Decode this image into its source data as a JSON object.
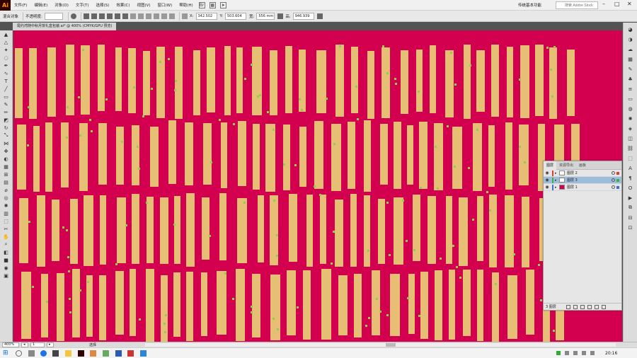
{
  "menubar": {
    "logo": "Ai",
    "items": [
      "文件(F)",
      "编辑(E)",
      "对象(O)",
      "文字(T)",
      "选择(S)",
      "效果(C)",
      "视图(V)",
      "窗口(W)",
      "帮助(H)"
    ],
    "workspace": "传统基本功能",
    "search_placeholder": "搜索 Adobe Stock"
  },
  "controlbar": {
    "mode_label": "混合对象",
    "opacity_label": "不透明度:",
    "opacity_value": "",
    "x_label": "X:",
    "x_value": "342.502",
    "y_label": "Y:",
    "y_value": "503.604",
    "w_label": "宽:",
    "w_value": "556 mm",
    "h_label": "高:",
    "h_value": "946.939"
  },
  "document": {
    "tab_title": "尾约湾随中秋月饼礼盒包装.ai* @ 400% (CMYK/GPU 预览)"
  },
  "layers_panel": {
    "tabs": [
      "图层",
      "资源导出",
      "画板"
    ],
    "layers": [
      {
        "name": "图层 2",
        "color": "#e03a3a",
        "selected": false
      },
      {
        "name": "图层 3",
        "color": "#3ab04a",
        "selected": true
      },
      {
        "name": "图层 1",
        "color": "#3a6fe0",
        "selected": false
      }
    ],
    "footer_count": "3 图层"
  },
  "statusbar": {
    "zoom": "400%",
    "page": "1",
    "tool": "选择"
  },
  "taskbar": {
    "time": "20:16"
  },
  "colors": {
    "artboard_bg": "#d2004e",
    "stripe": "#e6be74",
    "speck": "#8fd04a"
  }
}
